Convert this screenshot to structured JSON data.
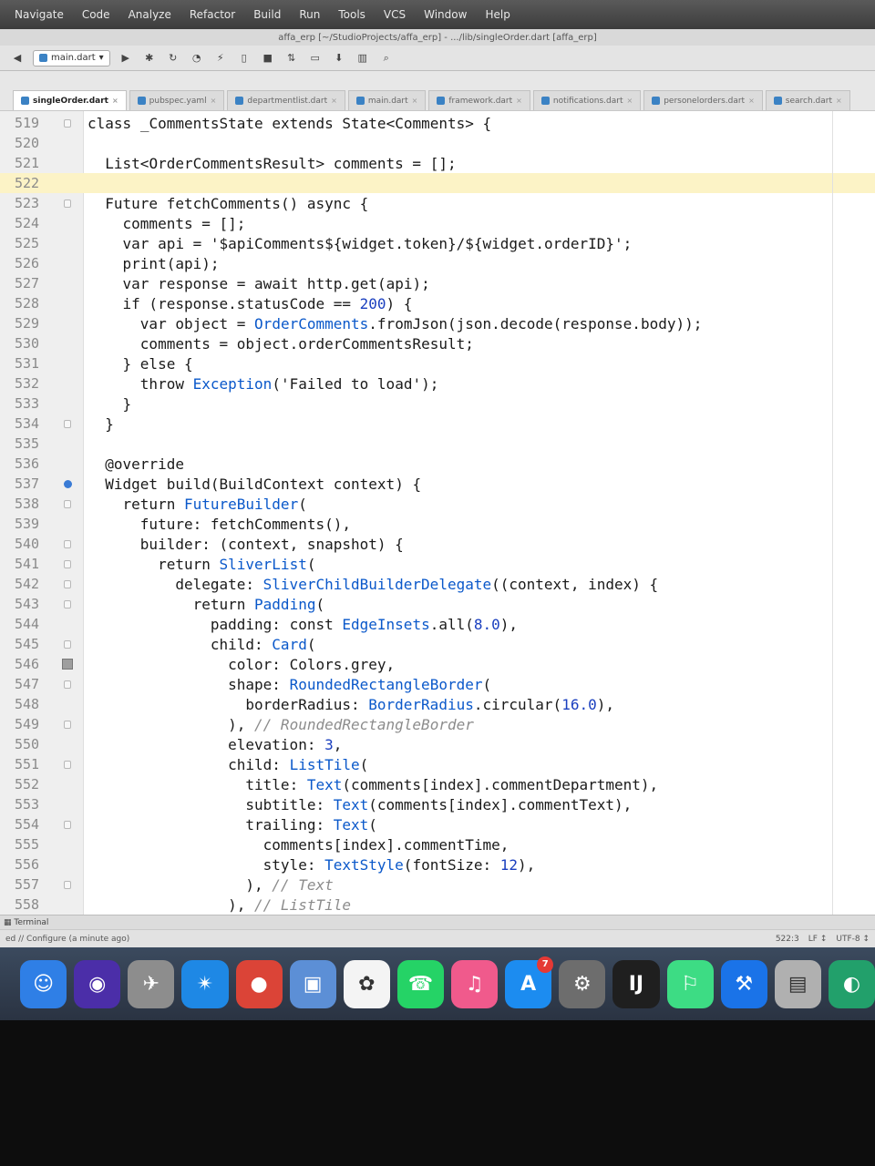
{
  "menubar": {
    "items": [
      "Navigate",
      "Code",
      "Analyze",
      "Refactor",
      "Build",
      "Run",
      "Tools",
      "VCS",
      "Window",
      "Help"
    ]
  },
  "window": {
    "title": "affa_erp [~/StudioProjects/affa_erp] - .../lib/singleOrder.dart [affa_erp]"
  },
  "toolbar": {
    "run_config": "main.dart"
  },
  "tabs": [
    {
      "label": "singleOrder.dart",
      "active": true
    },
    {
      "label": "pubspec.yaml",
      "active": false
    },
    {
      "label": "departmentlist.dart",
      "active": false
    },
    {
      "label": "main.dart",
      "active": false
    },
    {
      "label": "framework.dart",
      "active": false
    },
    {
      "label": "notifications.dart",
      "active": false
    },
    {
      "label": "personelorders.dart",
      "active": false
    },
    {
      "label": "search.dart",
      "active": false
    }
  ],
  "editor": {
    "lines": [
      {
        "n": "519",
        "text": "class _CommentsState extends State<Comments> {"
      },
      {
        "n": "520",
        "text": ""
      },
      {
        "n": "521",
        "text": "  List<OrderCommentsResult> comments = [];"
      },
      {
        "n": "522",
        "text": ""
      },
      {
        "n": "523",
        "text": "  Future fetchComments() async {"
      },
      {
        "n": "524",
        "text": "    comments = [];"
      },
      {
        "n": "525",
        "text": "    var api = '$apiComments${widget.token}/${widget.orderID}';"
      },
      {
        "n": "526",
        "text": "    print(api);"
      },
      {
        "n": "527",
        "text": "    var response = await http.get(api);"
      },
      {
        "n": "528",
        "text": "    if (response.statusCode == 200) {"
      },
      {
        "n": "529",
        "text": "      var object = OrderComments.fromJson(json.decode(response.body));"
      },
      {
        "n": "530",
        "text": "      comments = object.orderCommentsResult;"
      },
      {
        "n": "531",
        "text": "    } else {"
      },
      {
        "n": "532",
        "text": "      throw Exception('Failed to load');"
      },
      {
        "n": "533",
        "text": "    }"
      },
      {
        "n": "534",
        "text": "  }"
      },
      {
        "n": "535",
        "text": ""
      },
      {
        "n": "536",
        "text": "  @override"
      },
      {
        "n": "537",
        "text": "  Widget build(BuildContext context) {"
      },
      {
        "n": "538",
        "text": "    return FutureBuilder("
      },
      {
        "n": "539",
        "text": "      future: fetchComments(),"
      },
      {
        "n": "540",
        "text": "      builder: (context, snapshot) {"
      },
      {
        "n": "541",
        "text": "        return SliverList("
      },
      {
        "n": "542",
        "text": "          delegate: SliverChildBuilderDelegate((context, index) {"
      },
      {
        "n": "543",
        "text": "            return Padding("
      },
      {
        "n": "544",
        "text": "              padding: const EdgeInsets.all(8.0),"
      },
      {
        "n": "545",
        "text": "              child: Card("
      },
      {
        "n": "546",
        "text": "                color: Colors.grey,"
      },
      {
        "n": "547",
        "text": "                shape: RoundedRectangleBorder("
      },
      {
        "n": "548",
        "text": "                  borderRadius: BorderRadius.circular(16.0),"
      },
      {
        "n": "549",
        "text": "                ), // RoundedRectangleBorder"
      },
      {
        "n": "550",
        "text": "                elevation: 3,"
      },
      {
        "n": "551",
        "text": "                child: ListTile("
      },
      {
        "n": "552",
        "text": "                  title: Text(comments[index].commentDepartment),"
      },
      {
        "n": "553",
        "text": "                  subtitle: Text(comments[index].commentText),"
      },
      {
        "n": "554",
        "text": "                  trailing: Text("
      },
      {
        "n": "555",
        "text": "                    comments[index].commentTime,"
      },
      {
        "n": "556",
        "text": "                    style: TextStyle(fontSize: 12),"
      },
      {
        "n": "557",
        "text": "                  ), // Text"
      },
      {
        "n": "558",
        "text": "                ), // ListTile"
      }
    ],
    "highlighted_line": "522",
    "fold_lines": [
      "519",
      "523",
      "534",
      "538",
      "540",
      "541",
      "542",
      "543",
      "545",
      "547",
      "549",
      "551",
      "554",
      "557"
    ],
    "breakpoint_line": "537",
    "color_swatch_line": "546"
  },
  "bottom": {
    "terminal_label": "Terminal",
    "status_text": "ed // Configure (a minute ago)",
    "position": "522:3",
    "line_sep": "LF ↕",
    "encoding": "UTF-8 ↕"
  },
  "dock": {
    "apps": [
      {
        "name": "Finder",
        "color": "#2f7fe6",
        "glyph": "☺"
      },
      {
        "name": "Siri",
        "color": "#4b2ea8",
        "glyph": "◉"
      },
      {
        "name": "Launchpad",
        "color": "#8d8d8d",
        "glyph": "✈"
      },
      {
        "name": "Safari",
        "color": "#1e88e5",
        "glyph": "✴"
      },
      {
        "name": "Chrome",
        "color": "#db4437",
        "glyph": "●"
      },
      {
        "name": "Preview",
        "color": "#5c8fd6",
        "glyph": "▣"
      },
      {
        "name": "Photos",
        "color": "#f4f4f4",
        "glyph": "✿"
      },
      {
        "name": "WhatsApp",
        "color": "#25d366",
        "glyph": "☎"
      },
      {
        "name": "iTunes",
        "color": "#f05a8c",
        "glyph": "♫"
      },
      {
        "name": "App Store",
        "color": "#1c8cf0",
        "glyph": "A",
        "badge": "7"
      },
      {
        "name": "System Preferences",
        "color": "#6d6d6d",
        "glyph": "⚙"
      },
      {
        "name": "IntelliJ IDEA",
        "color": "#1f1f1f",
        "glyph": "IJ"
      },
      {
        "name": "Android Studio",
        "color": "#3ddc84",
        "glyph": "⚐"
      },
      {
        "name": "Xcode",
        "color": "#1a73e8",
        "glyph": "⚒"
      },
      {
        "name": "Image Capture",
        "color": "#b0b0b0",
        "glyph": "▤"
      },
      {
        "name": "Other App",
        "color": "#22a06b",
        "glyph": "◐"
      }
    ]
  }
}
